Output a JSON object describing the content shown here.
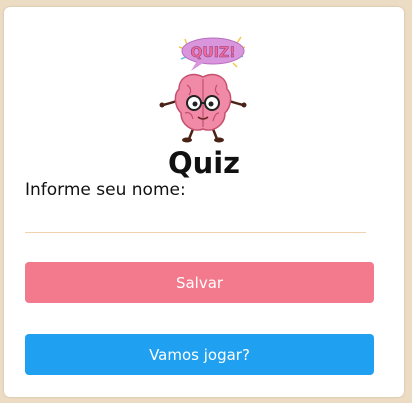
{
  "logo": {
    "badge_text": "QUIZ!"
  },
  "title": "Quiz",
  "form": {
    "name_label": "Informe seu nome:",
    "name_value": "",
    "name_placeholder": ""
  },
  "buttons": {
    "save_label": "Salvar",
    "play_label": "Vamos jogar?"
  },
  "colors": {
    "background": "#ecdcc4",
    "save_button": "#f27a8c",
    "play_button": "#1fa0f0",
    "input_underline": "#f0d2b0"
  }
}
